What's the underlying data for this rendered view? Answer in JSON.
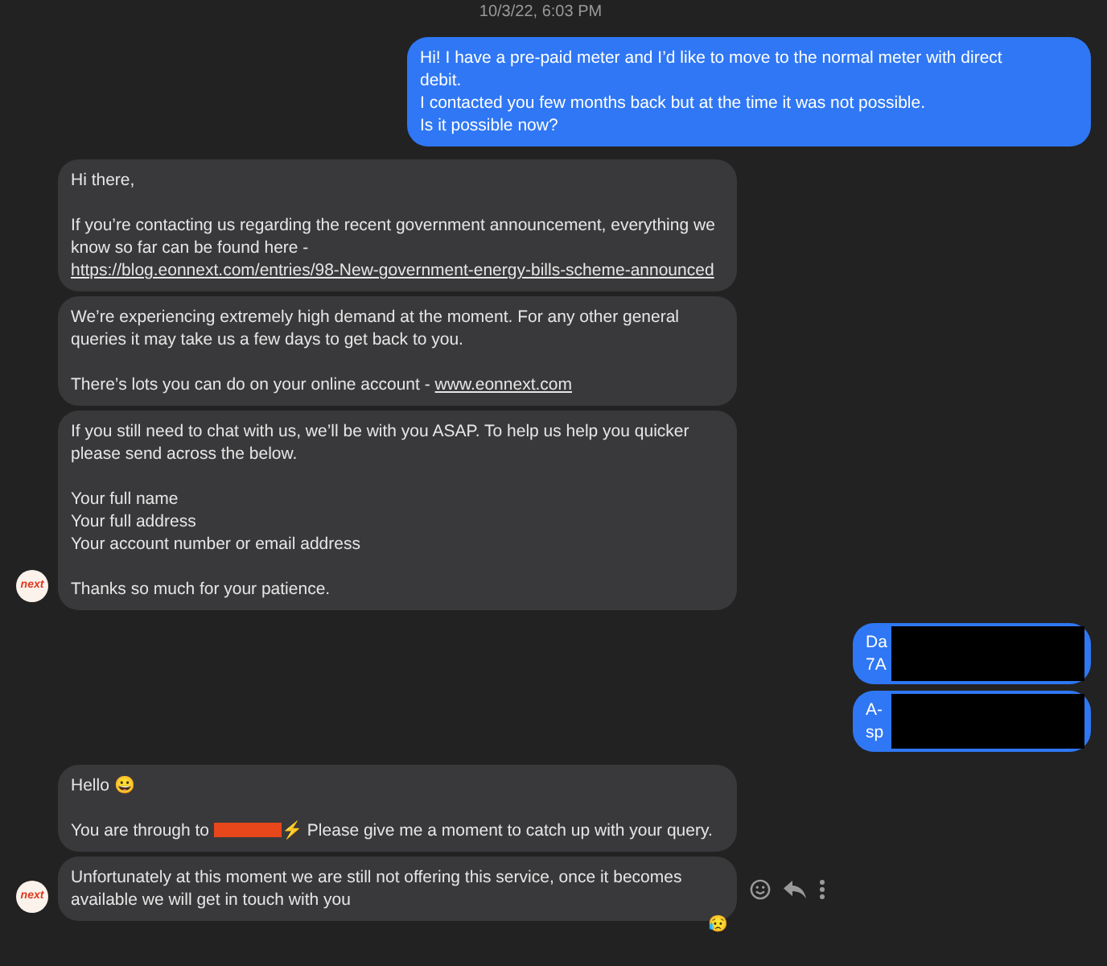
{
  "timestamp": "10/3/22, 6:03 PM",
  "groups": [
    {
      "kind": "sent",
      "bubbles": [
        {
          "paragraphs": [
            [
              [
                {
                  "kind": "text",
                  "text": "Hi! I have a pre-paid meter and I’d like to move to the normal meter with direct debit."
                }
              ],
              [
                {
                  "kind": "text",
                  "text": "I contacted you few months back but at the time it was not possible."
                }
              ],
              [
                {
                  "kind": "text",
                  "text": "Is it possible now?"
                }
              ]
            ]
          ]
        }
      ]
    },
    {
      "kind": "received",
      "avatar": {
        "logo": "next"
      },
      "bubbles": [
        {
          "paragraphs": [
            [
              [
                {
                  "kind": "text",
                  "text": "Hi there,"
                }
              ]
            ],
            [
              [
                {
                  "kind": "text",
                  "text": "If you’re contacting us regarding the recent government announcement, everything we know so far can be found here - "
                },
                {
                  "kind": "link_block",
                  "text": "https://blog.eonnext.com/entries/98-New-government-energy-bills-scheme-announced"
                }
              ]
            ]
          ]
        },
        {
          "paragraphs": [
            [
              [
                {
                  "kind": "text",
                  "text": "We’re experiencing extremely high demand at the moment. For any other general queries it may take us a few days to get back to you."
                }
              ]
            ],
            [
              [
                {
                  "kind": "text",
                  "text": "There’s lots you can do on your online account - "
                },
                {
                  "kind": "link",
                  "text": "www.eonnext.com"
                }
              ]
            ]
          ]
        },
        {
          "paragraphs": [
            [
              [
                {
                  "kind": "text",
                  "text": "If you still need to chat with us, we’ll be with you ASAP. To help us help you quicker please send across the below."
                }
              ]
            ],
            [
              [
                {
                  "kind": "text",
                  "text": "Your full name"
                }
              ],
              [
                {
                  "kind": "text",
                  "text": "Your full address"
                }
              ],
              [
                {
                  "kind": "text",
                  "text": "Your account number or email address"
                }
              ]
            ],
            [
              [
                {
                  "kind": "text",
                  "text": "Thanks so much for your patience."
                }
              ]
            ]
          ]
        }
      ]
    },
    {
      "kind": "sent",
      "bubbles": [
        {
          "paragraphs": [
            [
              [
                {
                  "kind": "text",
                  "text": "Da"
                }
              ],
              [
                {
                  "kind": "text",
                  "text": "7A"
                }
              ]
            ]
          ],
          "redaction": {
            "color": "#000000"
          }
        },
        {
          "paragraphs": [
            [
              [
                {
                  "kind": "text",
                  "text": "A-"
                }
              ],
              [
                {
                  "kind": "text",
                  "text": "sp"
                }
              ]
            ]
          ],
          "redaction": {
            "color": "#000000"
          }
        }
      ]
    },
    {
      "kind": "received",
      "avatar": {
        "logo": "next"
      },
      "bubbles": [
        {
          "paragraphs": [
            [
              [
                {
                  "kind": "text",
                  "text": "Hello 😀"
                }
              ]
            ],
            [
              [
                {
                  "kind": "text",
                  "text": "You are through to"
                },
                {
                  "kind": "redaction",
                  "color": "#e8461b"
                },
                {
                  "kind": "text",
                  "text": "⚡ Please give me a moment to catch up with your query."
                }
              ]
            ]
          ]
        },
        {
          "paragraphs": [
            [
              [
                {
                  "kind": "text",
                  "text": "Unfortunately at this moment we are still not offering this service, once it becomes available we will get in touch with you"
                }
              ]
            ]
          ],
          "reaction": "😥",
          "actions": true
        }
      ]
    }
  ]
}
